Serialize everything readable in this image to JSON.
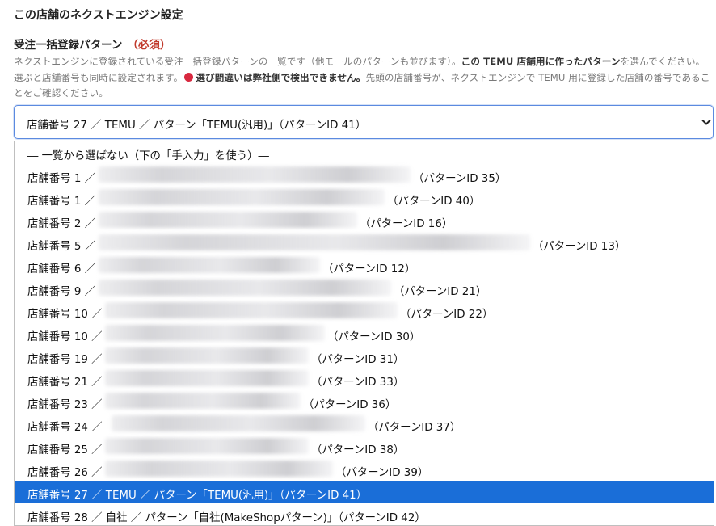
{
  "section_title": "この店舗のネクストエンジン設定",
  "field": {
    "label": "受注一括登録パターン",
    "required": "（必須）",
    "help_1": "ネクストエンジンに登録されている受注一括登録パターンの一覧です（他モールのパターンも並びます）。",
    "help_2": "この TEMU 店舗用に作ったパターン",
    "help_3": "を選んでください。選ぶと店舗番号も同時に設定されます。",
    "help_4": "選び間違いは弊社側で検出できません。",
    "help_5": "先頭の店舗番号が、ネクストエンジンで TEMU 用に登録した店舗の番号であることをご確認ください。"
  },
  "select": {
    "value": "店舗番号 27 ／ TEMU ／ パターン「TEMU(汎用)」（パターンID 41）"
  },
  "options": [
    {
      "text": "― 一覧から選ばない（下の「手入力」を使う）―",
      "suffix": ""
    },
    {
      "text": "店舗番号 1 ／",
      "suffix": "（パターンID 35）"
    },
    {
      "text": "店舗番号 1 ／",
      "suffix": "（パターンID 40）"
    },
    {
      "text": "店舗番号 2 ／",
      "suffix": "（パターンID 16）"
    },
    {
      "text": "店舗番号 5 ／",
      "suffix": "（パターンID 13）"
    },
    {
      "text": "店舗番号 6 ／",
      "suffix": "（パターンID 12）"
    },
    {
      "text": "店舗番号 9 ／",
      "suffix": "（パターンID 21）"
    },
    {
      "text": "店舗番号 10 ／",
      "suffix": "（パターンID 22）"
    },
    {
      "text": "店舗番号 10 ／",
      "suffix": "（パターンID 30）"
    },
    {
      "text": "店舗番号 19 ／",
      "suffix": "（パターンID 31）"
    },
    {
      "text": "店舗番号 21 ／",
      "suffix": "（パターンID 33）"
    },
    {
      "text": "店舗番号 23 ／",
      "suffix": "（パターンID 36）"
    },
    {
      "text": "店舗番号 24 ／",
      "suffix": "（パターンID 37）"
    },
    {
      "text": "店舗番号 25 ／",
      "suffix": "（パターンID 38）"
    },
    {
      "text": "店舗番号 26 ／",
      "suffix": "（パターンID 39）"
    },
    {
      "text": "店舗番号 27 ／ TEMU ／ パターン「TEMU(汎用)」（パターンID 41）",
      "suffix": "",
      "selected": true
    },
    {
      "text": "店舗番号 28 ／ 自社 ／ パターン「自社(MakeShopパターン)」（パターンID 42）",
      "suffix": ""
    }
  ],
  "colors": {
    "selected_bg": "#1a6ed8",
    "required": "#c0392b",
    "warning_dot": "#d8283f",
    "focus_border": "#5b8ae0"
  },
  "icons": {
    "select_arrow": "chevron-down-icon",
    "warning": "red-dot-icon"
  }
}
